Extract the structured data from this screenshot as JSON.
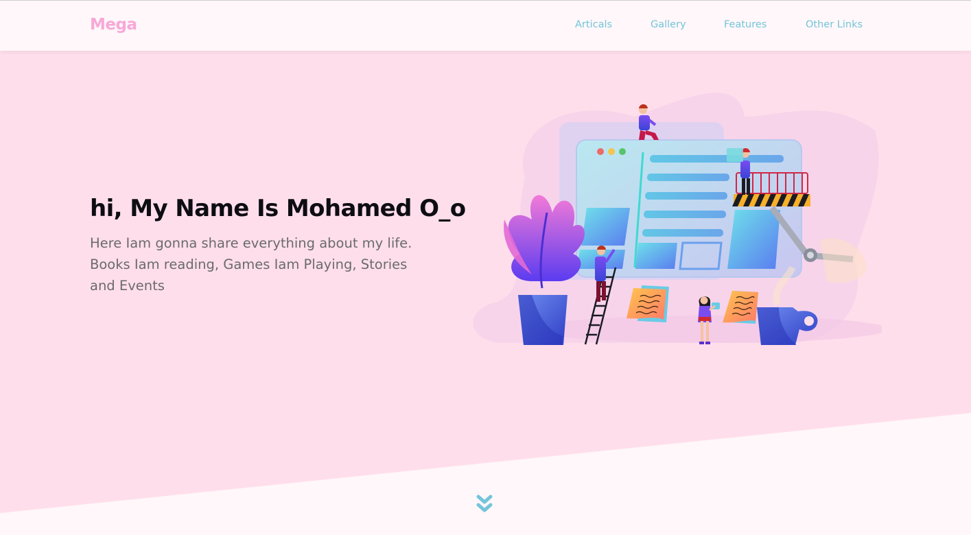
{
  "header": {
    "logo": "Mega",
    "nav": [
      "Articals",
      "Gallery",
      "Features",
      "Other Links"
    ]
  },
  "hero": {
    "title": "hi, My Name Is Mohamed O_o",
    "subtitle": "Here Iam gonna share everything about my life. Books Iam reading, Games Iam Playing, Stories and Events"
  },
  "scroll": {
    "icon": "double-chevron-down-icon"
  },
  "colors": {
    "logo": "#f7a8d8",
    "nav": "#73c5da",
    "hero_bg": "#ffdeeb",
    "page_bg": "#fff7f9",
    "title": "#0d0d12",
    "subtitle": "#6a6a6e",
    "accent": "#67c3d8"
  }
}
